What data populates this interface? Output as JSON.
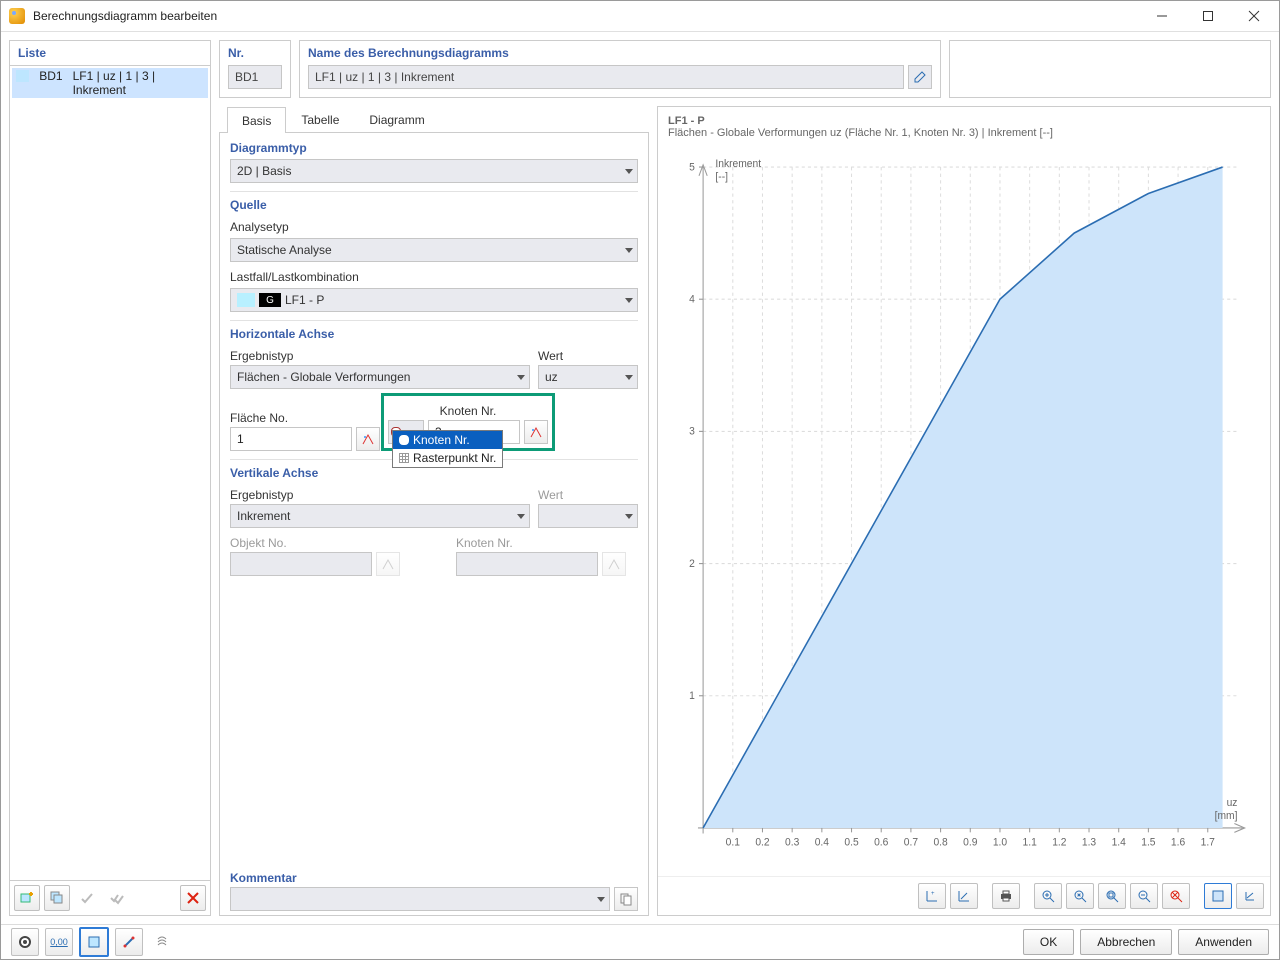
{
  "window": {
    "title": "Berechnungsdiagramm bearbeiten"
  },
  "list": {
    "header": "Liste",
    "items": [
      {
        "id": "BD1",
        "label": "LF1 | uz | 1 | 3 | Inkrement"
      }
    ]
  },
  "nr": {
    "header": "Nr.",
    "value": "BD1"
  },
  "name": {
    "header": "Name des Berechnungsdiagramms",
    "value": "LF1 | uᴢ | 1 | 3 | Inkrement"
  },
  "tabs": {
    "basis": "Basis",
    "tabelle": "Tabelle",
    "diagramm": "Diagramm"
  },
  "form": {
    "diagrammtyp": {
      "header": "Diagrammtyp",
      "value": "2D | Basis"
    },
    "quelle": {
      "header": "Quelle",
      "analysetyp_label": "Analysetyp",
      "analysetyp_value": "Statische Analyse",
      "lastfall_label": "Lastfall/Lastkombination",
      "lastfall_chip": "G",
      "lastfall_value": "LF1 - P"
    },
    "hachse": {
      "header": "Horizontale Achse",
      "ergebnistyp_label": "Ergebnistyp",
      "ergebnistyp_value": "Flächen - Globale Verformungen",
      "wert_label": "Wert",
      "wert_value": "uz",
      "flaeche_label": "Fläche No.",
      "flaeche_value": "1",
      "knoten_label": "Knoten Nr.",
      "knoten_value": "3",
      "popup": {
        "opt1": "Knoten Nr.",
        "opt2": "Rasterpunkt Nr."
      }
    },
    "vachse": {
      "header": "Vertikale Achse",
      "ergebnistyp_label": "Ergebnistyp",
      "ergebnistyp_value": "Inkrement",
      "wert_label": "Wert",
      "objekt_label": "Objekt No.",
      "knoten_label": "Knoten Nr."
    },
    "kommentar": {
      "header": "Kommentar"
    }
  },
  "chart_data": {
    "type": "area",
    "title": "LF1 - P",
    "subtitle": "Flächen - Globale Verformungen uᴢ (Fläche Nr. 1, Knoten Nr. 3) | Inkrement [--]",
    "xlabel": "uᴢ\n[mm]",
    "ylabel": "Inkrement\n[--]",
    "xlim": [
      0,
      1.8
    ],
    "ylim": [
      0,
      5
    ],
    "xticks": [
      0.1,
      0.2,
      0.3,
      0.4,
      0.5,
      0.6,
      0.7,
      0.8,
      0.9,
      1.0,
      1.1,
      1.2,
      1.3,
      1.4,
      1.5,
      1.6,
      1.7
    ],
    "yticks": [
      1,
      2,
      3,
      4,
      5
    ],
    "x": [
      0.0,
      0.25,
      0.5,
      0.75,
      1.0,
      1.25,
      1.5,
      1.75
    ],
    "y": [
      0,
      1,
      2,
      3,
      4,
      4.5,
      4.8,
      5.0
    ]
  },
  "buttons": {
    "ok": "OK",
    "cancel": "Abbrechen",
    "apply": "Anwenden"
  }
}
